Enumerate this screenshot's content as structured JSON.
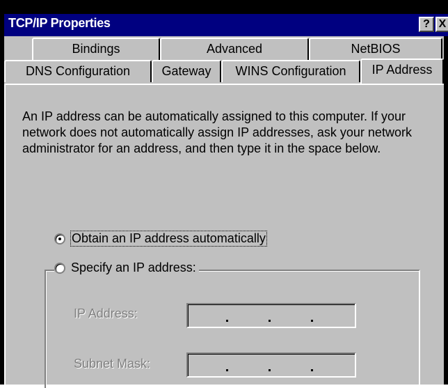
{
  "window": {
    "title": "TCP/IP Properties",
    "help_label": "?",
    "close_label": "X"
  },
  "tabs": {
    "row1": [
      "Bindings",
      "Advanced",
      "NetBIOS"
    ],
    "row2": [
      "DNS Configuration",
      "Gateway",
      "WINS Configuration",
      "IP Address"
    ],
    "active": "IP Address"
  },
  "panel": {
    "description": "An IP address can be automatically assigned to this computer. If your network does not automatically assign IP addresses, ask your network administrator for an address, and then type it in the space below.",
    "obtain_auto_label": "Obtain an IP address automatically",
    "specify_label": "Specify an IP address:",
    "selected_option": "obtain_auto",
    "ip_address_label": "IP Address:",
    "subnet_mask_label": "Subnet Mask:"
  },
  "colors": {
    "titlebar": "#000080",
    "face": "#c0c0c0",
    "disabled_text": "#808080"
  }
}
